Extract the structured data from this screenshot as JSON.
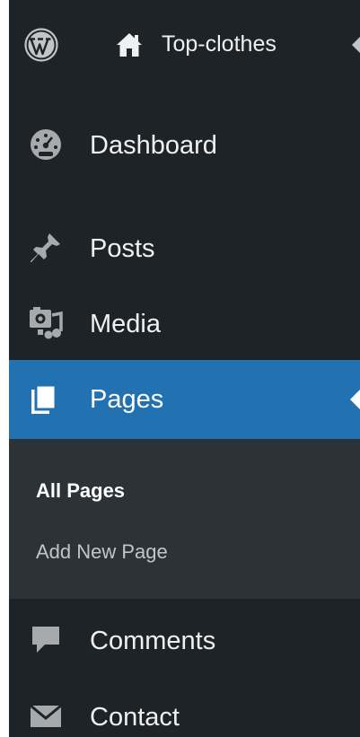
{
  "admin_bar": {
    "site_name": "Top-clothes",
    "icons": [
      "wordpress-logo-icon",
      "home-icon"
    ]
  },
  "menu": {
    "dashboard": {
      "label": "Dashboard",
      "icon": "dashboard-gauge-icon"
    },
    "posts": {
      "label": "Posts",
      "icon": "pushpin-icon"
    },
    "media": {
      "label": "Media",
      "icon": "media-camera-music-icon"
    },
    "pages": {
      "label": "Pages",
      "icon": "pages-icon",
      "current": true
    },
    "comments": {
      "label": "Comments",
      "icon": "comment-bubble-icon"
    },
    "contact": {
      "label": "Contact",
      "icon": "envelope-icon"
    }
  },
  "submenu": {
    "all_pages": "All Pages",
    "add_new_page": "Add New Page"
  },
  "colors": {
    "sidebar_bg": "#1d2327",
    "submenu_bg": "#2c3338",
    "accent": "#2271b1",
    "text": "#f0f0f1"
  }
}
